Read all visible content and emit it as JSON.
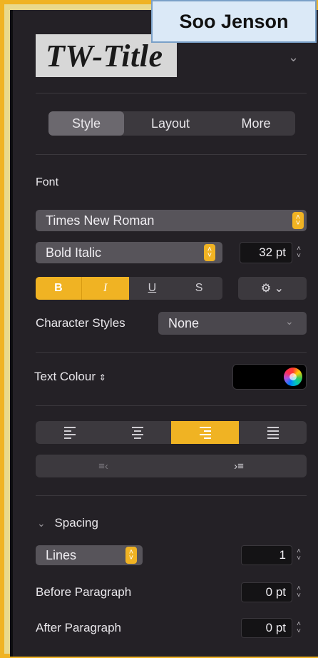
{
  "overlay": {
    "name": "Soo Jenson"
  },
  "style_preview": {
    "text": "TW-Title"
  },
  "tabs": [
    {
      "label": "Style",
      "active": true
    },
    {
      "label": "Layout",
      "active": false
    },
    {
      "label": "More",
      "active": false
    }
  ],
  "font": {
    "section_label": "Font",
    "family": "Times New Roman",
    "typeface": "Bold Italic",
    "size": "32 pt",
    "format_buttons": [
      {
        "label": "B",
        "active": true
      },
      {
        "label": "I",
        "active": true
      },
      {
        "label": "U",
        "active": false
      },
      {
        "label": "S",
        "active": false
      }
    ]
  },
  "character_styles": {
    "label": "Character Styles",
    "value": "None"
  },
  "text_colour": {
    "label": "Text Colour",
    "color": "#000000"
  },
  "alignment": {
    "selected": "right"
  },
  "spacing": {
    "section_label": "Spacing",
    "mode": "Lines",
    "mode_value": "1",
    "before_label": "Before Paragraph",
    "before_value": "0 pt",
    "after_label": "After Paragraph",
    "after_value": "0 pt"
  },
  "colors": {
    "accent": "#f0b323",
    "panel": "#242126",
    "border": "#f0b323"
  }
}
